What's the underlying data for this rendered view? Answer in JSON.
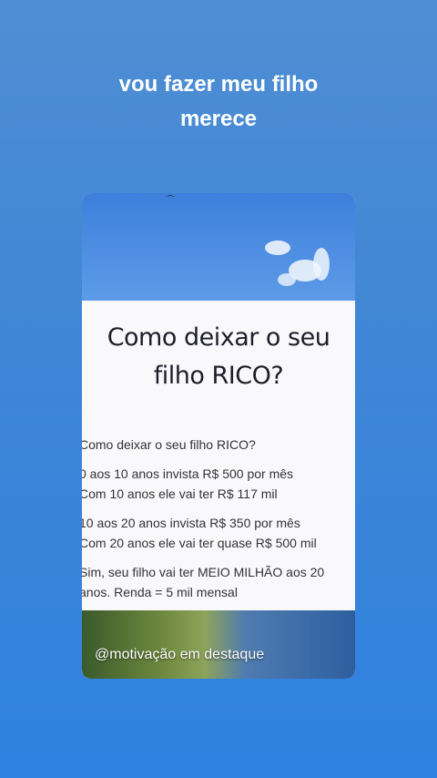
{
  "caption": {
    "line1": "vou fazer meu filho",
    "line2": "merece"
  },
  "card": {
    "headline": {
      "line1": "Como deixar o seu",
      "line2": "filho RICO?"
    },
    "paragraphs": [
      {
        "lines": [
          "Como deixar o seu filho RICO?"
        ]
      },
      {
        "lines": [
          "0 aos 10 anos invista R$ 500 por mês",
          "Com 10 anos ele vai ter R$ 117 mil"
        ]
      },
      {
        "lines": [
          "10 aos 20 anos invista R$ 350 por mês",
          "Com 20 anos ele vai ter quase R$ 500 mil"
        ]
      },
      {
        "lines": [
          "Sim, seu filho vai ter MEIO MILHÃO aos 20",
          "anos. Renda = 5 mil mensal"
        ]
      }
    ],
    "watermark": "@motivação em destaque"
  },
  "icons": {
    "bird": "bird-icon",
    "clouds": "cloud-icon"
  }
}
